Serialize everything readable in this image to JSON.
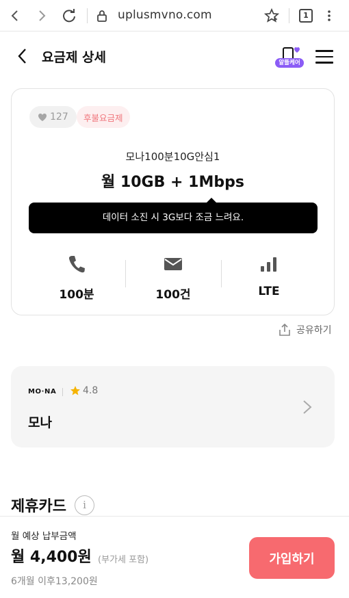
{
  "browser": {
    "url": "uplusmvno.com",
    "tab_count": "1"
  },
  "header": {
    "title": "요금제 상세",
    "logo_label": "알뜰케어"
  },
  "plan": {
    "likes": "127",
    "badge": "후불요금제",
    "name": "모나100분10G안심1",
    "main": "월 10GB + 1Mbps",
    "tooltip": "데이터 소진 시 3G보다 조금 느려요.",
    "features": [
      {
        "icon": "phone-icon",
        "value": "100분"
      },
      {
        "icon": "message-icon",
        "value": "100건"
      },
      {
        "icon": "signal-icon",
        "value": "LTE"
      }
    ]
  },
  "share_label": "공유하기",
  "operator": {
    "logo_text": "MO·NA",
    "rating": "4.8",
    "name": "모나"
  },
  "section": {
    "title": "제휴카드",
    "info": "i"
  },
  "bottom": {
    "label": "월 예상 납부금액",
    "price": "월 4,400원",
    "vat": "(부가세 포함)",
    "after": "6개월 이후13,200원",
    "cta": "가입하기"
  },
  "colors": {
    "accent": "#f76a6f",
    "badge_text": "#f0767c",
    "logo_purple": "#8b5cf6",
    "star": "#f5b301"
  }
}
